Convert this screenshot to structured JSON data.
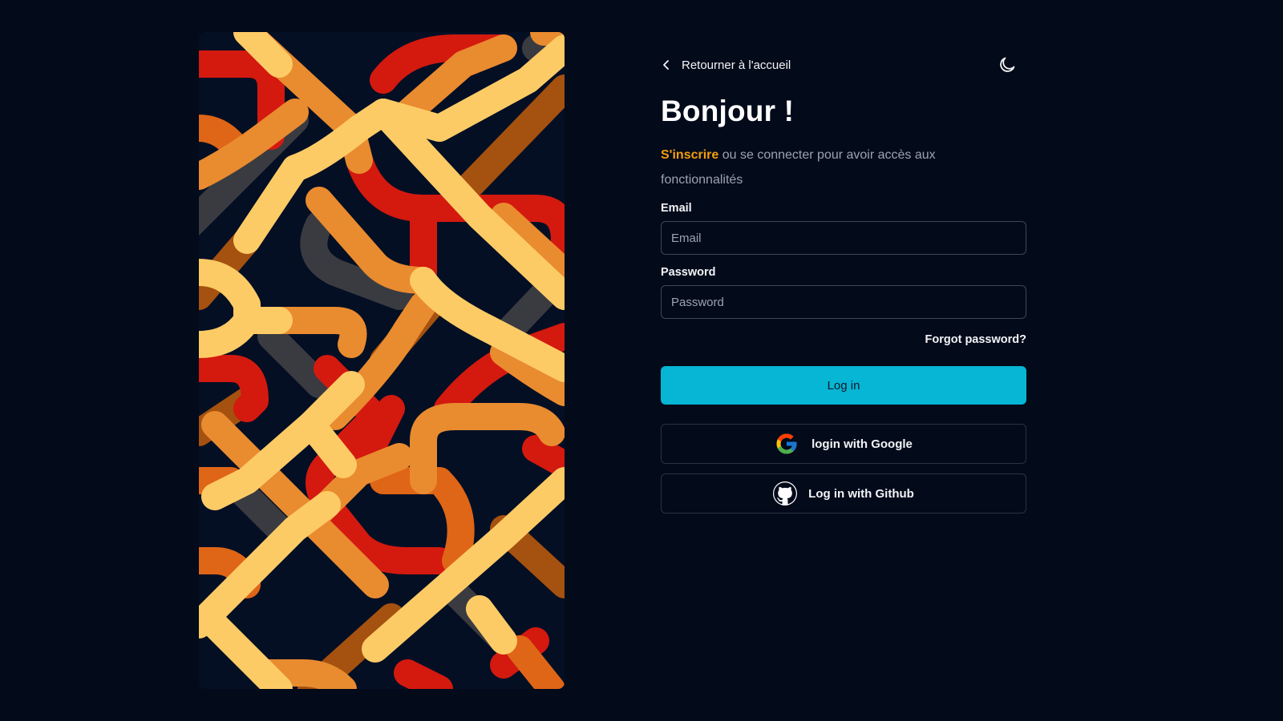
{
  "nav": {
    "back_label": "Retourner à l'accueil"
  },
  "header": {
    "title": "Bonjour !",
    "subtitle_link": "S'inscrire",
    "subtitle_rest": " ou se connecter pour avoir accès aux fonctionnalités"
  },
  "form": {
    "email_label": "Email",
    "email_placeholder": "Email",
    "email_value": "",
    "password_label": "Password",
    "password_placeholder": "Password",
    "password_value": "",
    "forgot_label": "Forgot password?",
    "login_label": "Log in"
  },
  "oauth": {
    "google_label": "login with Google",
    "github_label": "Log in with Github"
  },
  "icons": {
    "back": "chevron-left-icon",
    "theme": "moon-icon",
    "google": "google-icon",
    "github": "github-icon"
  },
  "colors": {
    "background": "#030a1a",
    "accent": "#06b6d4",
    "signup_link": "#f59e0b",
    "art_palette": [
      "#d4190f",
      "#e98b2f",
      "#fdcb66",
      "#a5510f",
      "#df6517",
      "#3a3b40"
    ]
  }
}
